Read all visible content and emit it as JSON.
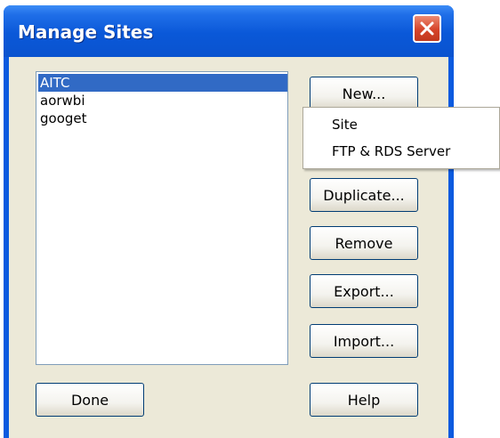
{
  "window": {
    "title": "Manage Sites"
  },
  "sites": {
    "items": [
      {
        "label": "AITC",
        "selected": true
      },
      {
        "label": "aorwbi",
        "selected": false
      },
      {
        "label": "googet",
        "selected": false
      }
    ]
  },
  "buttons": {
    "new": "New...",
    "duplicate": "Duplicate...",
    "remove": "Remove",
    "export": "Export...",
    "import": "Import...",
    "done": "Done",
    "help": "Help"
  },
  "new_menu": {
    "items": [
      "Site",
      "FTP & RDS Server"
    ]
  },
  "colors": {
    "titlebar": "#0a58d8",
    "selection": "#316ac5",
    "dialog_bg": "#ece9d8",
    "close_button": "#d6442a"
  }
}
